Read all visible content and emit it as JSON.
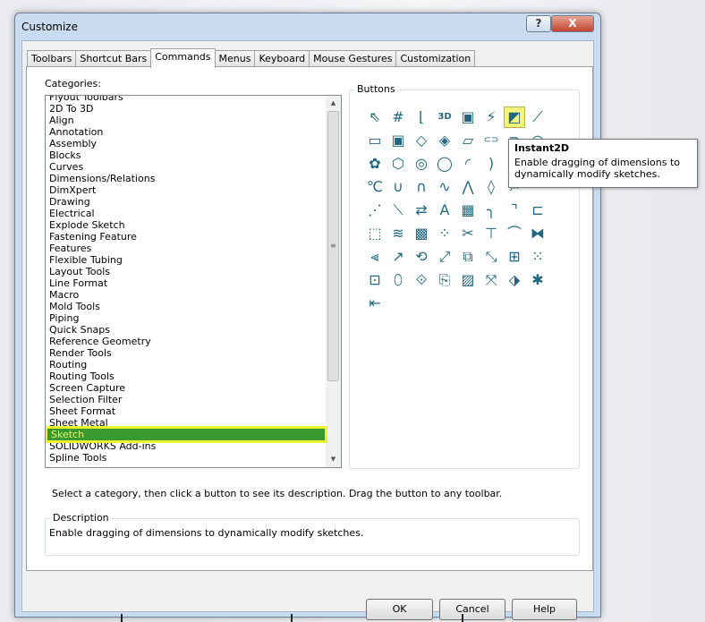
{
  "window": {
    "title": "Customize",
    "help_glyph": "?",
    "close_glyph": "X"
  },
  "tabs": [
    {
      "label": "Toolbars"
    },
    {
      "label": "Shortcut Bars"
    },
    {
      "label": "Commands",
      "active": true
    },
    {
      "label": "Menus"
    },
    {
      "label": "Keyboard"
    },
    {
      "label": "Mouse Gestures"
    },
    {
      "label": "Customization"
    }
  ],
  "categories": {
    "label": "Categories:",
    "selected": "Sketch",
    "items": [
      "Flyout Toolbars",
      "2D To 3D",
      "Align",
      "Annotation",
      "Assembly",
      "Blocks",
      "Curves",
      "Dimensions/Relations",
      "DimXpert",
      "Drawing",
      "Electrical",
      "Explode Sketch",
      "Fastening Feature",
      "Features",
      "Flexible Tubing",
      "Layout Tools",
      "Line Format",
      "Macro",
      "Mold Tools",
      "Piping",
      "Quick Snaps",
      "Reference Geometry",
      "Render Tools",
      "Routing",
      "Routing Tools",
      "Screen Capture",
      "Selection Filter",
      "Sheet Format",
      "Sheet Metal",
      "Sketch",
      "SOLIDWORKS Add-ins",
      "Spline Tools"
    ]
  },
  "buttons_group": {
    "label": "Buttons",
    "highlighted": "instant2d",
    "icons": [
      {
        "name": "select",
        "g": "⇖"
      },
      {
        "name": "grid",
        "g": "#"
      },
      {
        "name": "sketch",
        "g": "⌊"
      },
      {
        "name": "3d-sketch",
        "g": "3D"
      },
      {
        "name": "3d-sketch-on-plane",
        "g": "▣"
      },
      {
        "name": "quick-sketch",
        "g": "⚡"
      },
      {
        "name": "instant2d",
        "g": "◩"
      },
      {
        "name": "line",
        "g": "⟋"
      },
      {
        "name": "rectangle",
        "g": "▭"
      },
      {
        "name": "center-rectangle",
        "g": "▣"
      },
      {
        "name": "3-point-rectangle",
        "g": "◇"
      },
      {
        "name": "center-3-point-rectangle",
        "g": "◈"
      },
      {
        "name": "parallelogram",
        "g": "▱"
      },
      {
        "name": "slot",
        "g": "⊂⊃"
      },
      {
        "name": "centerpoint-slot",
        "g": "⊃"
      },
      {
        "name": "arc-slot",
        "g": "◠"
      },
      {
        "name": "polygon-shape",
        "g": "✿"
      },
      {
        "name": "polygon",
        "g": "⬡"
      },
      {
        "name": "circle",
        "g": "◎"
      },
      {
        "name": "perimeter-circle",
        "g": "◯"
      },
      {
        "name": "centerpoint-arc",
        "g": "◜"
      },
      {
        "name": "tangent-arc",
        "g": ")"
      },
      {
        "name": "three-point-arc",
        "g": "◡"
      },
      {
        "name": "ellipse",
        "g": "⬭"
      },
      {
        "name": "partial-ellipse",
        "g": "℃"
      },
      {
        "name": "parabola",
        "g": "∪"
      },
      {
        "name": "conic",
        "g": "∩"
      },
      {
        "name": "spline",
        "g": "∿"
      },
      {
        "name": "style-spline",
        "g": "⋀"
      },
      {
        "name": "spline-on-surface",
        "g": "◊"
      },
      {
        "name": "equation-curve",
        "g": "ƒx"
      },
      {
        "name": "point",
        "g": "·"
      },
      {
        "name": "centerline",
        "g": "⋰"
      },
      {
        "name": "midpoint-line",
        "g": "⟍"
      },
      {
        "name": "offset",
        "g": "⇄"
      },
      {
        "name": "text",
        "g": "A"
      },
      {
        "name": "plane",
        "g": "▦"
      },
      {
        "name": "fillet",
        "g": "╮"
      },
      {
        "name": "chamfer",
        "g": "⌝"
      },
      {
        "name": "offset-entities",
        "g": "⊏"
      },
      {
        "name": "convert-entities",
        "g": "⬚"
      },
      {
        "name": "intersection-curve",
        "g": "≋"
      },
      {
        "name": "face-curves",
        "g": "▩"
      },
      {
        "name": "segment",
        "g": "⁘"
      },
      {
        "name": "trim",
        "g": "✂"
      },
      {
        "name": "extend",
        "g": "⊤"
      },
      {
        "name": "split-entities",
        "g": "⌒"
      },
      {
        "name": "mirror",
        "g": "⧓"
      },
      {
        "name": "dynamic-mirror",
        "g": "⫷"
      },
      {
        "name": "move",
        "g": "↗"
      },
      {
        "name": "rotate",
        "g": "⟲"
      },
      {
        "name": "scale",
        "g": "⤢"
      },
      {
        "name": "copy",
        "g": "⧉"
      },
      {
        "name": "stretch",
        "g": "⤡"
      },
      {
        "name": "linear-pattern",
        "g": "⊞"
      },
      {
        "name": "circular-pattern",
        "g": "⁙"
      },
      {
        "name": "block",
        "g": "⊡"
      },
      {
        "name": "loop",
        "g": "⬯"
      },
      {
        "name": "move-entities",
        "g": "⟐"
      },
      {
        "name": "copy-entities",
        "g": "⎘"
      },
      {
        "name": "sketch-picture",
        "g": "▨"
      },
      {
        "name": "fix",
        "g": "⤧"
      },
      {
        "name": "relation",
        "g": "⬗"
      },
      {
        "name": "auto-dimension",
        "g": "✱"
      },
      {
        "name": "snap-point",
        "g": "⇤"
      }
    ]
  },
  "tooltip": {
    "title": "Instant2D",
    "text": "Enable dragging of dimensions to dynamically modify sketches."
  },
  "hint": "Select a category, then click a button to see its description. Drag the button to any toolbar.",
  "description": {
    "label": "Description",
    "text": "Enable dragging of dimensions to dynamically modify sketches."
  },
  "footer": {
    "ok": "OK",
    "cancel": "Cancel",
    "help": "Help"
  },
  "colors": {
    "selection": "#37992f",
    "highlight": "#f0f42c",
    "icon": "#236680"
  }
}
